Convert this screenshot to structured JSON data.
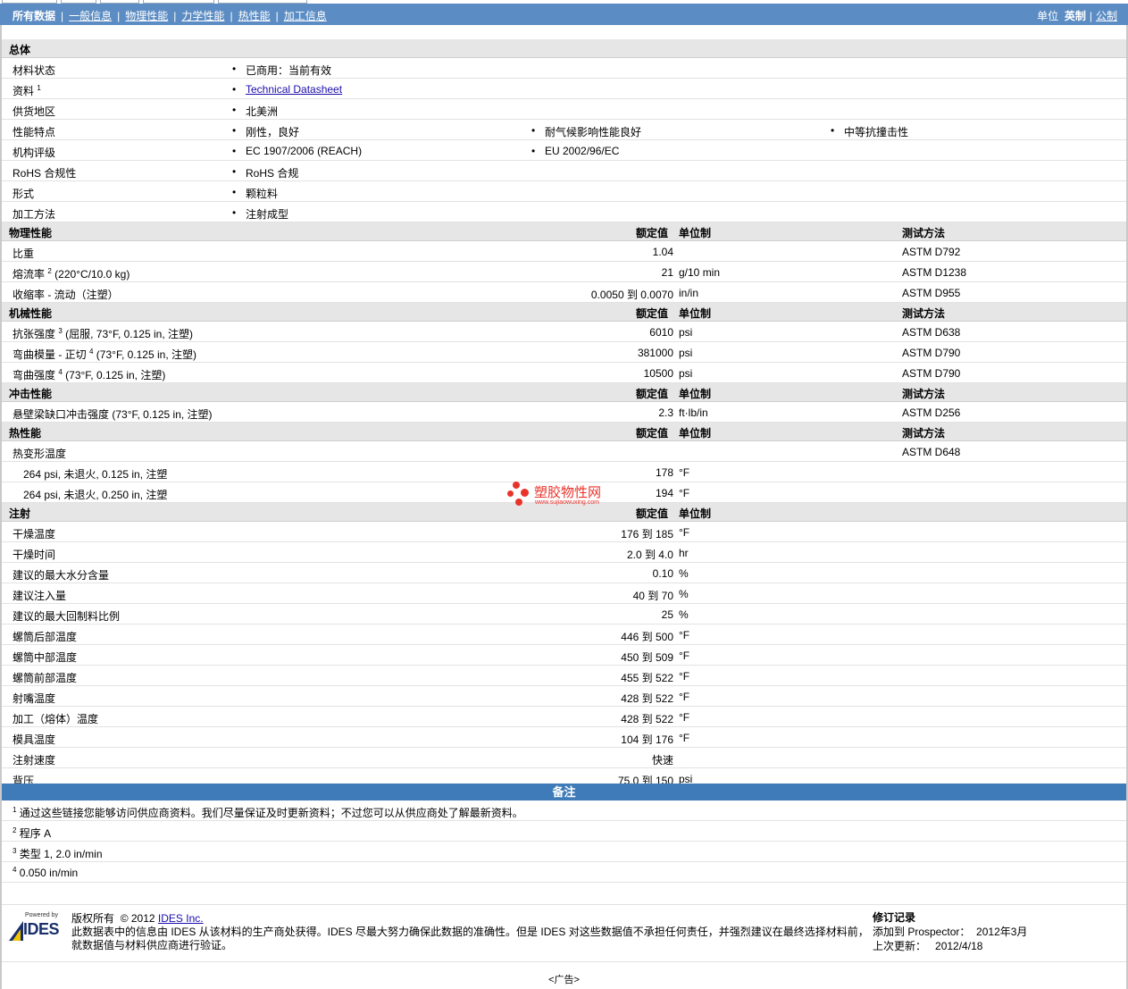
{
  "nav": {
    "links": [
      "所有数据",
      "一般信息",
      "物理性能",
      "力学性能",
      "热性能",
      "加工信息"
    ],
    "units_label": "单位",
    "unit_imperial": "英制",
    "unit_metric": "公制"
  },
  "columns": {
    "nominal": "额定值",
    "unit": "单位制",
    "method": "测试方法"
  },
  "general": {
    "title": "总体",
    "status_label": "材料状态",
    "status_value": "已商用：当前有效",
    "resource_label": "资料",
    "resource_link": "Technical Datasheet",
    "region_label": "供货地区",
    "region_value": "北美洲",
    "features_label": "性能特点",
    "features": [
      "刚性，良好",
      "耐气候影响性能良好",
      "中等抗撞击性"
    ],
    "agency_label": "机构评级",
    "agency": [
      "EC 1907/2006 (REACH)",
      "EU 2002/96/EC"
    ],
    "rohs_label": "RoHS 合规性",
    "rohs_value": "RoHS 合规",
    "form_label": "形式",
    "form_value": "颗粒料",
    "process_label": "加工方法",
    "process_value": "注射成型"
  },
  "physical": {
    "title": "物理性能",
    "rows": [
      {
        "label": "比重",
        "sup": "",
        "cond": "",
        "value": "1.04",
        "unit": "",
        "method": "ASTM D792"
      },
      {
        "label": "熔流率",
        "sup": "2",
        "cond": " (220°C/10.0 kg)",
        "value": "21",
        "unit": "g/10 min",
        "method": "ASTM D1238"
      },
      {
        "label": "收缩率  - 流动（注塑）",
        "sup": "",
        "cond": "",
        "value": "0.0050 到  0.0070",
        "unit": "in/in",
        "method": "ASTM D955"
      }
    ]
  },
  "mechanical": {
    "title": "机械性能",
    "rows": [
      {
        "label": "抗张强度",
        "sup": "3",
        "cond": " (屈服, 73°F, 0.125 in, 注塑)",
        "value": "6010",
        "unit": "psi",
        "method": "ASTM D638"
      },
      {
        "label": "弯曲模量  - 正切",
        "sup": "4",
        "cond": " (73°F, 0.125 in, 注塑)",
        "value": "381000",
        "unit": "psi",
        "method": "ASTM D790"
      },
      {
        "label": "弯曲强度",
        "sup": "4",
        "cond": " (73°F, 0.125 in, 注塑)",
        "value": "10500",
        "unit": "psi",
        "method": "ASTM D790"
      }
    ]
  },
  "impact": {
    "title": "冲击性能",
    "rows": [
      {
        "label": "悬壁梁缺口冲击强度",
        "sup": "",
        "cond": " (73°F, 0.125 in, 注塑)",
        "value": "2.3",
        "unit": "ft·lb/in",
        "method": "ASTM D256"
      }
    ]
  },
  "thermal": {
    "title": "热性能",
    "main_label": "热变形温度",
    "main_method": "ASTM D648",
    "rows": [
      {
        "label": "264 psi, 未退火, 0.125 in, 注塑",
        "value": "178",
        "unit": "°F"
      },
      {
        "label": "264 psi, 未退火, 0.250 in, 注塑",
        "value": "194",
        "unit": "°F"
      }
    ]
  },
  "injection": {
    "title": "注射",
    "rows": [
      {
        "label": "干燥温度",
        "value": "176 到  185",
        "unit": "°F"
      },
      {
        "label": "干燥时间",
        "value": "2.0 到  4.0",
        "unit": "hr"
      },
      {
        "label": "建议的最大水分含量",
        "value": "0.10",
        "unit": "%"
      },
      {
        "label": "建议注入量",
        "value": "40 到  70",
        "unit": "%"
      },
      {
        "label": "建议的最大回制料比例",
        "value": "25",
        "unit": "%"
      },
      {
        "label": "螺筒后部温度",
        "value": "446 到  500",
        "unit": "°F"
      },
      {
        "label": "螺筒中部温度",
        "value": "450 到  509",
        "unit": "°F"
      },
      {
        "label": "螺筒前部温度",
        "value": "455 到  522",
        "unit": "°F"
      },
      {
        "label": "射嘴温度",
        "value": "428 到  522",
        "unit": "°F"
      },
      {
        "label": "加工（熔体）温度",
        "value": "428 到  522",
        "unit": "°F"
      },
      {
        "label": "模具温度",
        "value": "104 到  176",
        "unit": "°F"
      },
      {
        "label": "注射速度",
        "value": "快速",
        "unit": ""
      },
      {
        "label": "背压",
        "value": "75.0 到  150",
        "unit": "psi"
      }
    ]
  },
  "notes": {
    "title": "备注",
    "items": [
      {
        "num": "1",
        "text": "通过这些链接您能够访问供应商资料。我们尽量保证及时更新资料；不过您可以从供应商处了解最新资料。"
      },
      {
        "num": "2",
        "text": "程序  A"
      },
      {
        "num": "3",
        "text": "类型  1, 2.0 in/min"
      },
      {
        "num": "4",
        "text": "0.050 in/min"
      }
    ]
  },
  "footer": {
    "powered": "Powered by",
    "logo_text": "IDES",
    "copyright_label": "版权所有",
    "copyright_year": "© 2012",
    "company_link": "IDES Inc.",
    "disclaimer_1": "此数据表中的信息由  IDES 从该材料的生产商处获得。IDES 尽最大努力确保此数据的准确性。但是  IDES 对这些数据值不承担任何责任，并强烈建议在最终选择材料前，",
    "disclaimer_2": "就数据值与材料供应商进行验证。",
    "revision_title": "修订记录",
    "added_label": "添加到  Prospector：",
    "added_value": "2012年3月",
    "updated_label": "上次更新：",
    "updated_value": "2012/4/18"
  },
  "ad_label": "<广告>",
  "watermark": {
    "brand": "塑胶物性网",
    "url": "www.sujiaowuxing.com"
  },
  "colors": {
    "nav_bg": "#5b8cc3",
    "notes_bg": "#3f7bb8",
    "section_bg": "#e6e6e6",
    "watermark": "#e8332b"
  }
}
